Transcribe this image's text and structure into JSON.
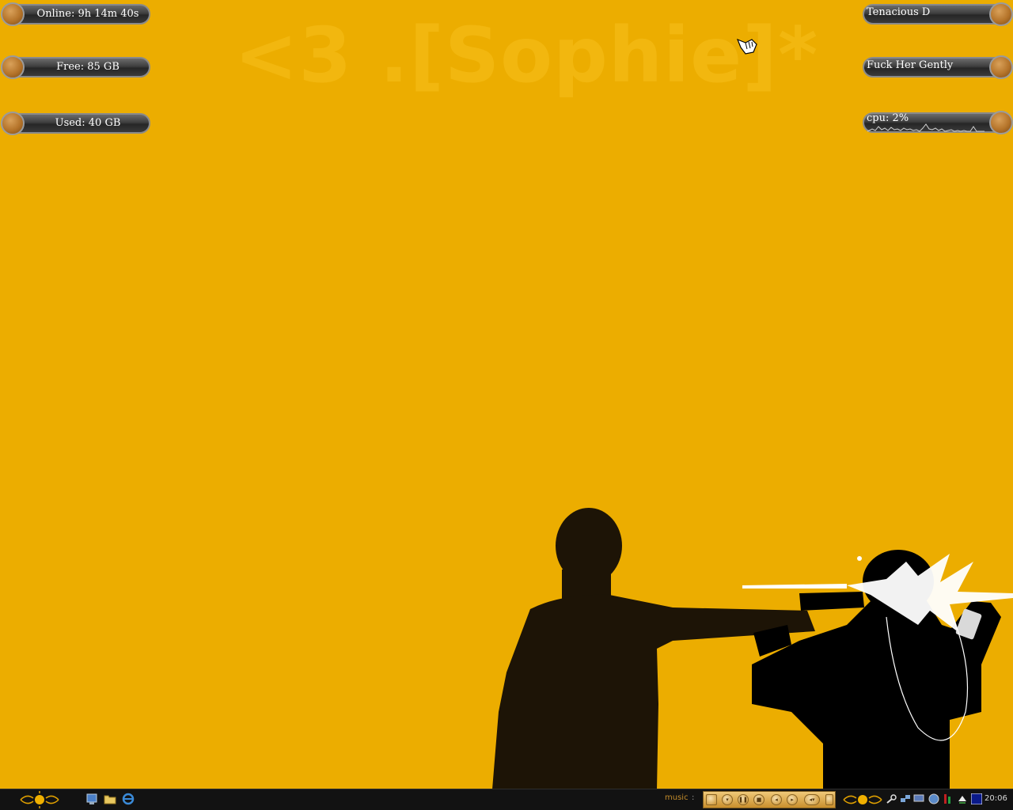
{
  "wallpaper": {
    "title": "<3 .[Sophie]*"
  },
  "widgets_left": [
    {
      "label": "Online: 9h 14m 40s"
    },
    {
      "label": "Free: 85 GB"
    },
    {
      "label": "Used: 40 GB"
    }
  ],
  "widgets_right": {
    "now_playing_artist": "Tenacious D",
    "now_playing_track": "Fuck Her Gently",
    "cpu_label": "cpu: 2%"
  },
  "taskbar": {
    "quick_launch": [
      "desktop-icon",
      "folder-icon",
      "ie-icon"
    ],
    "music_label": "music",
    "clock": "20:06"
  },
  "colors": {
    "background": "#ecad00",
    "silhouette": "#1d1406",
    "taskbar": "#121212"
  }
}
